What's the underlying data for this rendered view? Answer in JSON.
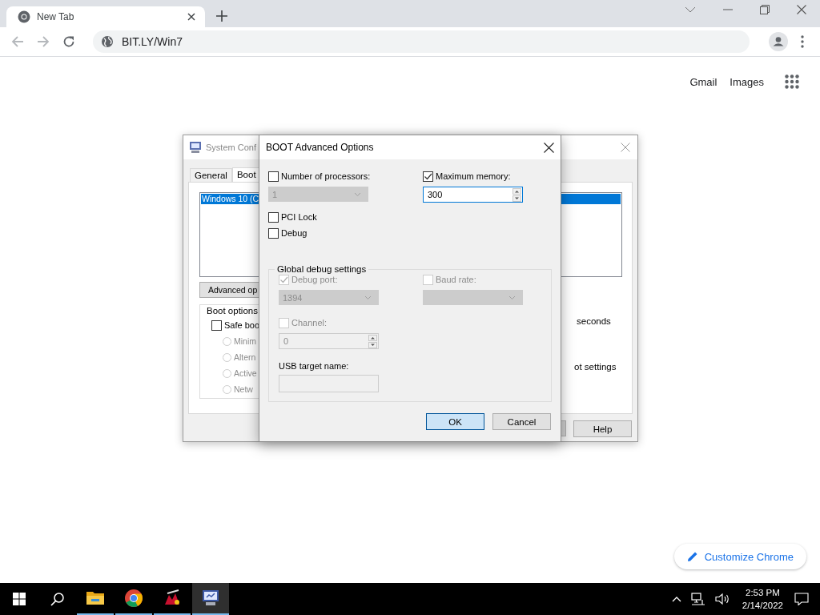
{
  "browser": {
    "tab": {
      "title": "New Tab",
      "selected": true
    },
    "address": "BIT.LY/Win7"
  },
  "page": {
    "links": [
      "Gmail",
      "Images"
    ],
    "customize_button": "Customize Chrome"
  },
  "system_config": {
    "title": "System Conf",
    "tabs": [
      {
        "label": "General",
        "selected": false
      },
      {
        "label": "Boot",
        "selected": true
      }
    ],
    "boot_list": [
      {
        "label": "Windows 10 (C",
        "selected": true
      }
    ],
    "advanced_button": "Advanced op",
    "boot_options_label": "Boot options",
    "safe_boot": {
      "label": "Safe boo",
      "checked": false
    },
    "safe_boot_modes": [
      {
        "label": "Minim",
        "selected": false,
        "disabled": true
      },
      {
        "label": "Altern",
        "selected": false,
        "disabled": true
      },
      {
        "label": "Active",
        "selected": false,
        "disabled": true
      },
      {
        "label": "Netw",
        "selected": false,
        "disabled": true
      }
    ],
    "timeout_unit": "seconds",
    "permanent_label": "ot settings",
    "help_button": "Help"
  },
  "dialog": {
    "title": "BOOT Advanced Options",
    "processors": {
      "label": "Number of processors:",
      "checked": false,
      "value": "1",
      "disabled": true
    },
    "max_memory": {
      "label": "Maximum memory:",
      "checked": true,
      "value": "300"
    },
    "options": [
      {
        "label": "PCI Lock",
        "checked": false
      },
      {
        "label": "Debug",
        "checked": false
      }
    ],
    "debug_group": {
      "title": "Global debug settings",
      "debug_port": {
        "label": "Debug port:",
        "checked": true,
        "disabled": true,
        "value": "1394"
      },
      "baud_rate": {
        "label": "Baud rate:",
        "checked": false,
        "disabled": true
      },
      "channel": {
        "label": "Channel:",
        "checked": false,
        "disabled": true,
        "value": "0"
      },
      "usb_target": {
        "label": "USB target name:",
        "disabled": true
      }
    },
    "buttons": [
      {
        "label": "OK",
        "default": true
      },
      {
        "label": "Cancel",
        "default": false
      }
    ]
  },
  "taskbar": {
    "apps": [
      {
        "kind": "explorer",
        "active": false
      },
      {
        "kind": "chrome",
        "active": false
      },
      {
        "kind": "game",
        "active": false
      },
      {
        "kind": "sysconfig",
        "active": true
      }
    ],
    "time": "2:53 PM",
    "date": "2/14/2022"
  }
}
